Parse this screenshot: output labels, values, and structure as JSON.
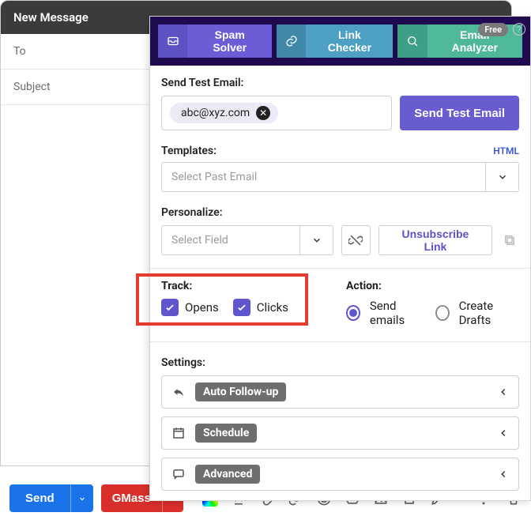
{
  "compose": {
    "title": "New Message",
    "to_label": "To",
    "subject_label": "Subject",
    "send_label": "Send",
    "gmass_label": "GMass"
  },
  "panel": {
    "free_badge": "Free",
    "tabs": {
      "spam": "Spam Solver",
      "link": "Link Checker",
      "analyzer": "Email Analyzer"
    },
    "send_test_label": "Send Test Email:",
    "test_email_value": "abc@xyz.com",
    "send_test_button": "Send Test Email",
    "templates_label": "Templates:",
    "templates_html": "HTML",
    "templates_placeholder": "Select Past Email",
    "personalize_label": "Personalize:",
    "personalize_placeholder": "Select Field",
    "unsubscribe_label": "Unsubscribe Link",
    "track": {
      "label": "Track:",
      "opens": {
        "label": "Opens",
        "checked": true
      },
      "clicks": {
        "label": "Clicks",
        "checked": true
      }
    },
    "action": {
      "label": "Action:",
      "send_emails": {
        "label": "Send emails",
        "selected": true
      },
      "create_drafts": {
        "label": "Create Drafts",
        "selected": false
      }
    },
    "settings": {
      "label": "Settings:",
      "auto_followup": "Auto Follow-up",
      "schedule": "Schedule",
      "advanced": "Advanced"
    }
  }
}
